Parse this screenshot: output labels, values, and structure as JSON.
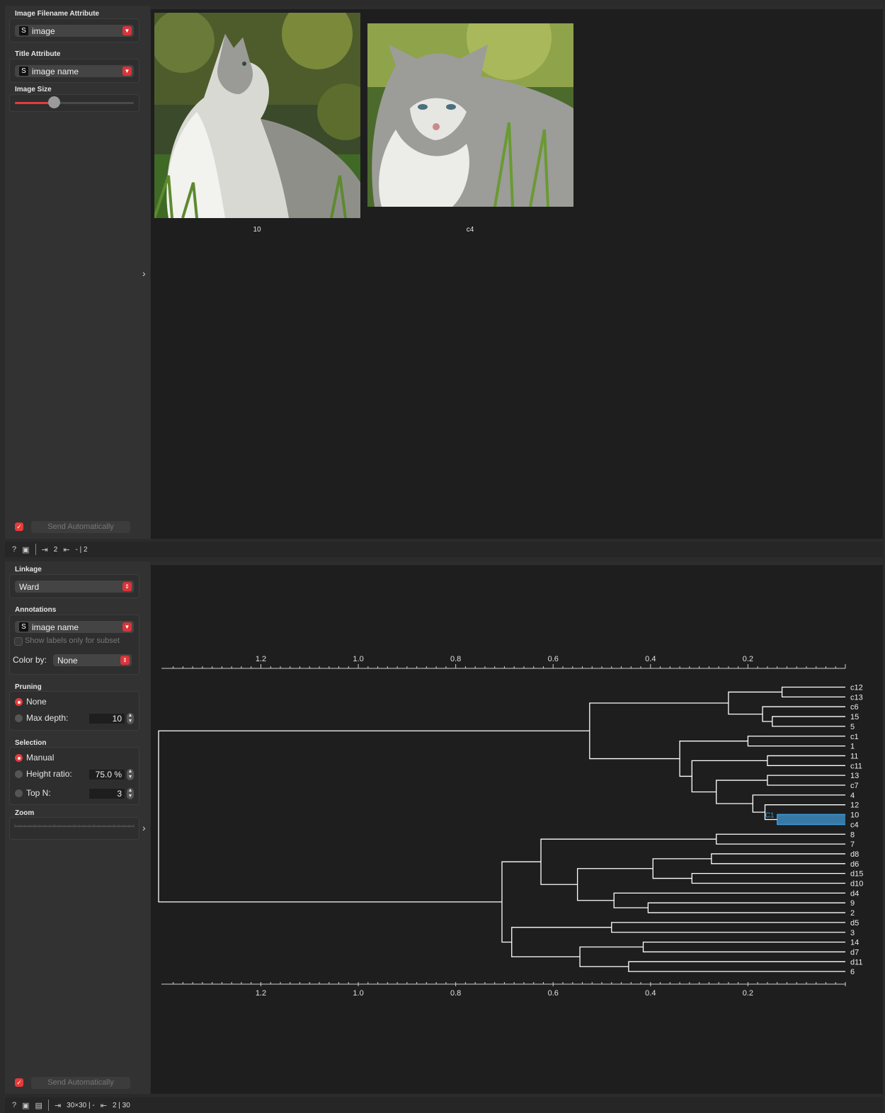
{
  "image_viewer": {
    "filename_attr": {
      "title": "Image Filename Attribute",
      "type_tag": "S",
      "value": "image"
    },
    "title_attr": {
      "title": "Title Attribute",
      "type_tag": "S",
      "value": "image name"
    },
    "image_size": {
      "title": "Image Size",
      "value_fraction": 0.33
    },
    "send_auto_label": "Send Automatically",
    "images": [
      {
        "caption": "10"
      },
      {
        "caption": "c4"
      }
    ],
    "status": {
      "input_count": "2",
      "output_count": "- | 2"
    }
  },
  "dendrogram": {
    "linkage": {
      "title": "Linkage",
      "value": "Ward"
    },
    "annotations": {
      "title": "Annotations",
      "type_tag": "S",
      "value": "image name",
      "subset_label": "Show labels only for subset",
      "color_by_label": "Color by:",
      "color_by_value": "None"
    },
    "pruning": {
      "title": "Pruning",
      "none_label": "None",
      "max_depth_label": "Max depth:",
      "max_depth_value": "10"
    },
    "selection": {
      "title": "Selection",
      "manual_label": "Manual",
      "height_ratio_label": "Height ratio:",
      "height_ratio_value": "75.0 %",
      "top_n_label": "Top N:",
      "top_n_value": "3"
    },
    "zoom": {
      "title": "Zoom"
    },
    "send_auto_label": "Send Automatically",
    "status": {
      "input_count": "30×30 | -",
      "output_count": "2 | 30"
    },
    "selection_cluster_label": "C1"
  },
  "chart_data": {
    "type": "dendrogram",
    "axis_ticks": [
      "1.2",
      "1.0",
      "0.8",
      "0.6",
      "0.4",
      "0.2"
    ],
    "axis_tick_values": [
      1.2,
      1.0,
      0.8,
      0.6,
      0.4,
      0.2
    ],
    "xlim": [
      1.41,
      0.0
    ],
    "leaves": [
      "c12",
      "c13",
      "c6",
      "15",
      "5",
      "c1",
      "1",
      "11",
      "c11",
      "13",
      "c7",
      "4",
      "12",
      "10",
      "c4",
      "8",
      "7",
      "d8",
      "d6",
      "d15",
      "d10",
      "d4",
      "9",
      "2",
      "d5",
      "3",
      "14",
      "d7",
      "d11",
      "6"
    ],
    "merges": [
      {
        "a": "c12",
        "b": "c13",
        "h": 0.13,
        "id": "m1"
      },
      {
        "a": "15",
        "b": "5",
        "h": 0.15,
        "id": "m2"
      },
      {
        "a": "c6",
        "b": "m2",
        "h": 0.17,
        "id": "m3"
      },
      {
        "a": "m1",
        "b": "m3",
        "h": 0.24,
        "id": "m4"
      },
      {
        "a": "c1",
        "b": "1",
        "h": 0.2,
        "id": "m5"
      },
      {
        "a": "11",
        "b": "c11",
        "h": 0.16,
        "id": "m6"
      },
      {
        "a": "13",
        "b": "c7",
        "h": 0.16,
        "id": "m7"
      },
      {
        "a": "10",
        "b": "c4",
        "h": 0.14,
        "id": "m8"
      },
      {
        "a": "12",
        "b": "m8",
        "h": 0.165,
        "id": "m9"
      },
      {
        "a": "4",
        "b": "m9",
        "h": 0.19,
        "id": "m10"
      },
      {
        "a": "m7",
        "b": "m10",
        "h": 0.265,
        "id": "m11"
      },
      {
        "a": "m6",
        "b": "m11",
        "h": 0.315,
        "id": "m12"
      },
      {
        "a": "m5",
        "b": "m12",
        "h": 0.34,
        "id": "m13"
      },
      {
        "a": "m4",
        "b": "m13",
        "h": 0.525,
        "id": "m14"
      },
      {
        "a": "8",
        "b": "7",
        "h": 0.265,
        "id": "m15"
      },
      {
        "a": "d8",
        "b": "d6",
        "h": 0.275,
        "id": "m16"
      },
      {
        "a": "d15",
        "b": "d10",
        "h": 0.315,
        "id": "m17"
      },
      {
        "a": "m16",
        "b": "m17",
        "h": 0.395,
        "id": "m18"
      },
      {
        "a": "9",
        "b": "2",
        "h": 0.405,
        "id": "m19"
      },
      {
        "a": "d4",
        "b": "m19",
        "h": 0.475,
        "id": "m20"
      },
      {
        "a": "m18",
        "b": "m20",
        "h": 0.55,
        "id": "m21"
      },
      {
        "a": "m15",
        "b": "m21",
        "h": 0.625,
        "id": "m22"
      },
      {
        "a": "d5",
        "b": "3",
        "h": 0.48,
        "id": "m23"
      },
      {
        "a": "14",
        "b": "d7",
        "h": 0.415,
        "id": "m24"
      },
      {
        "a": "d11",
        "b": "6",
        "h": 0.445,
        "id": "m25"
      },
      {
        "a": "m24",
        "b": "m25",
        "h": 0.545,
        "id": "m26"
      },
      {
        "a": "m23",
        "b": "m26",
        "h": 0.685,
        "id": "m27"
      },
      {
        "a": "m22",
        "b": "m27",
        "h": 0.705,
        "id": "m28"
      },
      {
        "a": "m14",
        "b": "m28",
        "h": 1.41,
        "id": "m29"
      }
    ],
    "selected_cluster": {
      "leaves": [
        "10",
        "c4"
      ],
      "label": "C1"
    }
  }
}
